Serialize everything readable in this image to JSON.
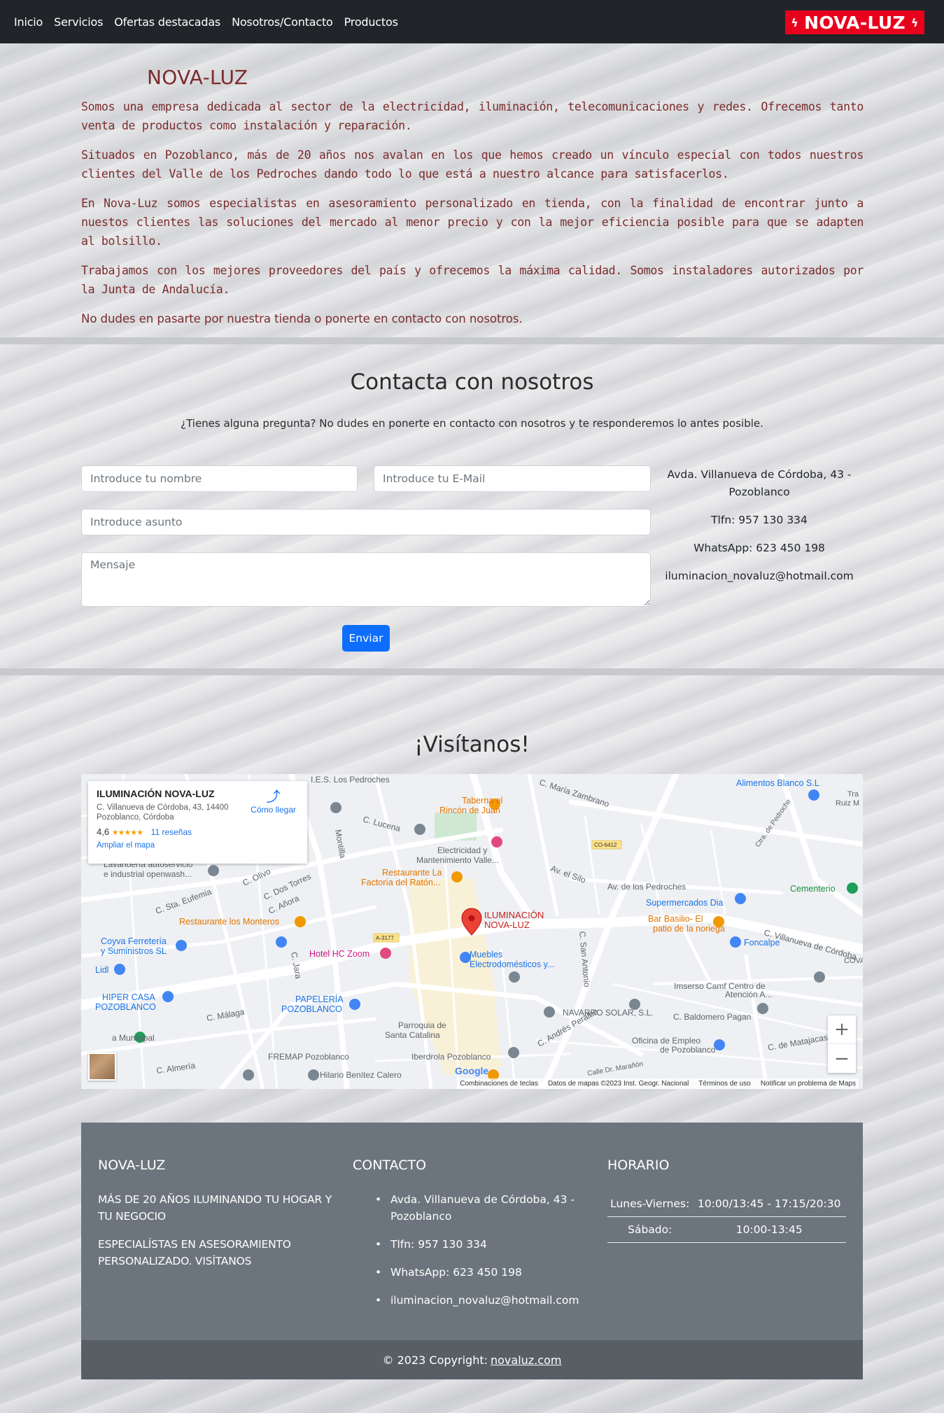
{
  "nav": {
    "links": [
      "Inicio",
      "Servicios",
      "Ofertas destacadas",
      "Nosotros/Contacto",
      "Productos"
    ],
    "logo_text": "NOVA-LUZ",
    "logo_bolt": "⚡"
  },
  "about": {
    "title": "NOVA-LUZ",
    "paragraphs": [
      "Somos una empresa dedicada al sector de la electricidad, iluminación, telecomunicaciones y redes. Ofrecemos tanto venta de productos como instalación y reparación.",
      "Situados en Pozoblanco, más de 20 años nos avalan en los que hemos creado un vínculo especial con todos nuestros clientes del Valle de los Pedroches dando todo lo que está a nuestro alcance para satisfacerlos.",
      "En Nova-Luz somos especialistas en asesoramiento personalizado en tienda, con la finalidad de encontrar junto a nuestos clientes las soluciones del mercado al menor precio y con la mejor eficiencia posible para que se adapten al bolsillo.",
      "Trabajamos con los mejores proveedores del país y ofrecemos la máxima calidad. Somos instaladores autorizados por la Junta de Andalucía.",
      "No dudes en pasarte por nuestra tienda o ponerte en contacto con nosotros."
    ]
  },
  "contact": {
    "title": "Contacta con nosotros",
    "subtitle": "¿Tienes alguna pregunta? No dudes en ponerte en contacto con nosotros y te responderemos lo antes posible.",
    "name_placeholder": "Introduce tu nombre",
    "email_placeholder": "Introduce tu E-Mail",
    "subject_placeholder": "Introduce asunto",
    "message_placeholder": "Mensaje",
    "send_label": "Enviar",
    "address": "Avda. Villanueva de Córdoba, 43 - Pozoblanco",
    "phone": "Tlfn: 957 130 334",
    "whatsapp": "WhatsApp: 623 450 198",
    "email": "iluminacion_novaluz@hotmail.com"
  },
  "visit": {
    "title": "¡Visítanos!",
    "map": {
      "place_name": "ILUMINACIÓN NOVA-LUZ",
      "place_address": "C. Villanueva de Córdoba, 43, 14400 Pozoblanco, Córdoba",
      "rating": "4,6",
      "stars": "★★★★★",
      "reviews": "11 reseñas",
      "enlarge": "Ampliar el mapa",
      "directions": "Cómo llegar",
      "marker_label_1": "ILUMINACIÓN",
      "marker_label_2": "NOVA-LUZ",
      "zoom_in": "+",
      "zoom_out": "−",
      "google": "Google",
      "footer_items": [
        "Combinaciones de teclas",
        "Datos de mapas ©2023 Inst. Geogr. Nacional",
        "Términos de uso",
        "Notificar un problema de Maps"
      ],
      "labels": {
        "ies": "I.E.S. Los Pedroches",
        "maria": "C. María Zambrano",
        "alimentos": "Alimentos Blanco S.L",
        "taberna1": "Taberna el",
        "taberna2": "Rincón de Juan",
        "lucena": "C. Lucena",
        "montilla": "Montilla",
        "elec1": "Electricidad y",
        "elec2": "Mantenimiento Valle...",
        "co": "CO-6412",
        "silo": "Av. el Silo",
        "lav1": "Lavandería autoservicio",
        "lav2": "e industrial openwash...",
        "olivo": "C. Olivo",
        "dos": "C. Dos Torres",
        "rest1": "Restaurante La",
        "rest2": "Factoría del Ratón...",
        "pedroches": "Av. de los Pedroches",
        "cementerio": "Cementerio",
        "superdia": "Supermercados Dia",
        "eufemia": "C. Sta. Eufemia",
        "anora": "C. Añora",
        "monteros": "Restaurante los Monteros",
        "basilio1": "Bar Basilio- El",
        "basilio2": "patio de la noriega",
        "villanueva": "C. Villanueva de Córdoba",
        "coyva1": "Coyva Ferretería",
        "coyva2": "y Suministros SL",
        "a3177": "A-3177",
        "hotel": "Hotel HC Zoom",
        "muebles1": "Muebles",
        "muebles2": "Electrodomésticos y...",
        "foncalpe": "Foncalpe",
        "lidl": "Lidl",
        "jara": "C. Jara",
        "sanantonio": "C. San Antonio",
        "imserso1": "Imserso Camf Centro de",
        "imserso2": "Atención A...",
        "hiper1": "HIPER CASA",
        "hiper2": "POZOBLANCO",
        "papeleria1": "PAPELERÍA",
        "papeleria2": "POZOBLANCO",
        "navarro": "NAVARRO SOLAR, S.L.",
        "municipal": "a Municipal",
        "malaga": "C. Málaga",
        "parroquia1": "Parroquia de",
        "parroquia2": "Santa Catalina",
        "peralbo": "C. Andrés Peralbo",
        "baldomero": "C. Baldomero Pagan",
        "oficina1": "Oficina de Empleo",
        "oficina2": "de Pozoblanco",
        "matajacas": "C. de Matajacas",
        "fremap": "FREMAP Pozoblanco",
        "iberdrola": "Iberdrola Pozoblanco",
        "almeria": "C. Almería",
        "hilario": "Hilario Benítez Calero",
        "dr": "Calle Dr. Marañón",
        "pedroche": "Ctra. de Pedroche",
        "cova": "COVA",
        "tra1": "Tra",
        "tra2": "Ruiz M"
      }
    }
  },
  "footer": {
    "col1_title": "NOVA-LUZ",
    "col1_p1": "MÁS DE 20 AÑOS ILUMINANDO TU HOGAR Y TU NEGOCIO",
    "col1_p2": "ESPECIALÍSTAS EN ASESORAMIENTO PERSONALIZADO. VISÍTANOS",
    "col2_title": "CONTACTO",
    "col2_items": [
      "Avda. Villanueva de Córdoba, 43 - Pozoblanco",
      "Tlfn: 957 130 334",
      "WhatsApp: 623 450 198",
      "iluminacion_novaluz@hotmail.com"
    ],
    "col3_title": "HORARIO",
    "hours": [
      {
        "day": "Lunes-Viernes:",
        "time": "10:00/13:45 - 17:15/20:30"
      },
      {
        "day": "Sábado:",
        "time": "10:00-13:45"
      }
    ],
    "copyright": "© 2023 Copyright:",
    "copyright_link": "novaluz.com"
  }
}
